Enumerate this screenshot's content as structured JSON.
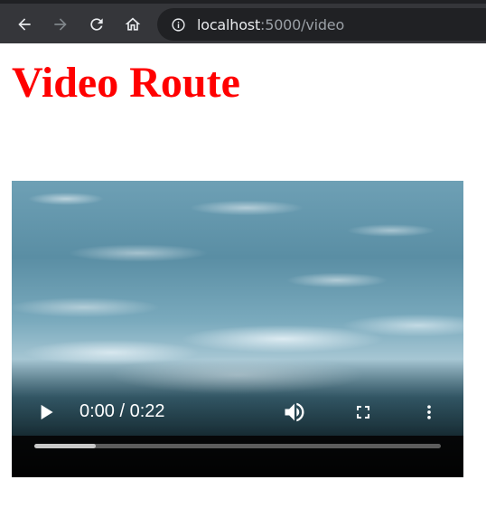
{
  "browser": {
    "url_host": "localhost",
    "url_path": ":5000/video",
    "icons": {
      "back": "arrow-left-icon",
      "forward": "arrow-right-icon",
      "reload": "reload-icon",
      "home": "home-icon",
      "info": "info-icon"
    }
  },
  "page": {
    "title": "Video Route",
    "title_color": "#ff0000"
  },
  "video": {
    "current_time": "0:00",
    "duration": "0:22",
    "time_display": "0:00 / 0:22",
    "buffered_fraction": 0.15,
    "playing": false,
    "icons": {
      "play": "play-icon",
      "volume": "volume-icon",
      "fullscreen": "fullscreen-icon",
      "more": "more-vertical-icon"
    }
  }
}
